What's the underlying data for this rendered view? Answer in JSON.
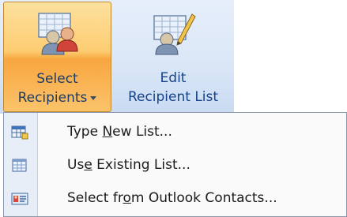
{
  "ribbon": {
    "select_recipients": {
      "line1": "Select",
      "line2": "Recipients",
      "state": "pressed"
    },
    "edit_recipient_list": {
      "line1": "Edit",
      "line2": "Recipient List"
    }
  },
  "menu": {
    "items": [
      {
        "label_pre": "Type ",
        "label_key": "N",
        "label_post": "ew List...",
        "icon": "new-list-icon"
      },
      {
        "label_pre": "Us",
        "label_key": "e",
        "label_post": " Existing List...",
        "icon": "existing-list-icon"
      },
      {
        "label_pre": "Select fr",
        "label_key": "o",
        "label_post": "m Outlook Contacts...",
        "icon": "outlook-contacts-icon"
      }
    ]
  },
  "colors": {
    "accent": "#fdcc72",
    "ribbon_text": "#15428b"
  }
}
